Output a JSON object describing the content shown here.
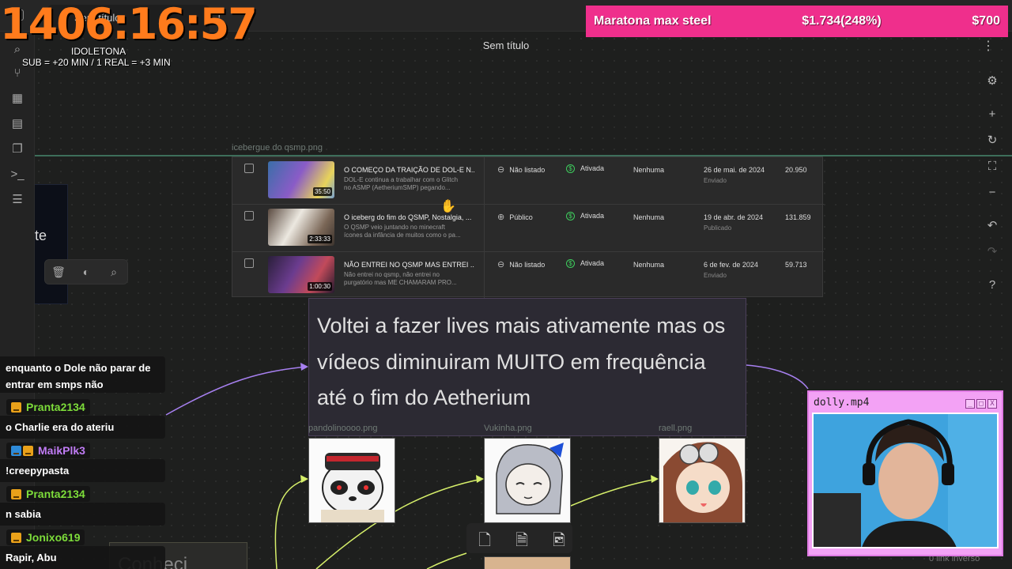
{
  "topbar": {
    "tab_label": "Sem título",
    "new_tab": "+"
  },
  "page": {
    "title": "Sem título",
    "menu_icon": "vertical-dots-icon"
  },
  "overlay": {
    "timer": "1406:16:57",
    "timer_title": "IDOLETONA",
    "timer_rule": "SUB = +20  MIN / 1 REAL = +3 MIN",
    "marathon_name": "Maratona max steel",
    "marathon_progress": "$1.734(248%)",
    "marathon_goal": "$700"
  },
  "sidebar": {
    "icons": [
      "search-icon",
      "graph-icon",
      "grid-icon",
      "calendar-icon",
      "copy-icon",
      "terminal-icon",
      "list-icon"
    ]
  },
  "rightbar": {
    "icons": [
      "settings-icon",
      "zoom-in-icon",
      "refresh-icon",
      "fullscreen-icon",
      "zoom-out-icon",
      "undo-icon",
      "redo-icon",
      "help-icon"
    ]
  },
  "canvas": {
    "file_labels": {
      "iceberg": "icebergue do qsmp.png",
      "pandolino": "pandolinoooo.png",
      "vukinha": "Vukinha.png",
      "raell": "raell.png"
    },
    "left_card_text": "te",
    "note_text": "Voltei a fazer lives mais ativamente mas os vídeos diminuiram MUITO em frequência até o fim do Aetherium",
    "conheci_text": "Conheci",
    "footer_text": "0 link inverso"
  },
  "videos": [
    {
      "title": "O COMEÇO DA TRAIÇÃO DE DOL-E N...",
      "desc1": "DOL-E continua a trabalhar com o Glitch",
      "desc2": "no ASMP (AetheriumSMP) pegando...",
      "duration": "35:50",
      "visibility": "Não listado",
      "monetization": "Ativada",
      "restrictions": "Nenhuma",
      "date": "26 de mai. de 2024",
      "status": "Enviado",
      "views": "20.950"
    },
    {
      "title": "O iceberg do fim do QSMP, Nostalgia, ...",
      "desc1": "O QSMP veio juntando no minecraft",
      "desc2": "ícones da infância de muitos como o pa...",
      "duration": "2:33:33",
      "visibility": "Público",
      "monetization": "Ativada",
      "restrictions": "Nenhuma",
      "date": "19 de abr. de 2024",
      "status": "Publicado",
      "views": "131.859"
    },
    {
      "title": "NÃO ENTREI NO QSMP MAS ENTREI ...",
      "desc1": "Não entrei no qsmp, não entrei no",
      "desc2": "purgatório mas ME CHAMARAM PRO...",
      "duration": "1:00:30",
      "visibility": "Não listado",
      "monetization": "Ativada",
      "restrictions": "Nenhuma",
      "date": "6 de fev. de 2024",
      "status": "Enviado",
      "views": "59.713"
    }
  ],
  "chat": {
    "msg1": "enquanto o Dole não parar de entrar em smps não",
    "user1": "Pranta2134",
    "msg2": "o Charlie era do ateriu",
    "user2": "MaikPlk3",
    "msg3": "!creepypasta",
    "user3": "Pranta2134",
    "msg4": "n sabia",
    "user4": "Jonixo619",
    "msg5": "Rapir, Abu",
    "colors": {
      "user1": "#7ddc3a",
      "user2": "#c07cf5",
      "user3": "#7ddc3a",
      "user4": "#7ddc3a"
    }
  },
  "webcam": {
    "title": "dolly.mp4",
    "buttons": [
      "_",
      "□",
      "X"
    ]
  },
  "colors": {
    "accent": "#ef2f8c",
    "timer": "#ff7b1c",
    "edge_green": "#d6ef6a",
    "edge_purple": "#a780f0"
  }
}
